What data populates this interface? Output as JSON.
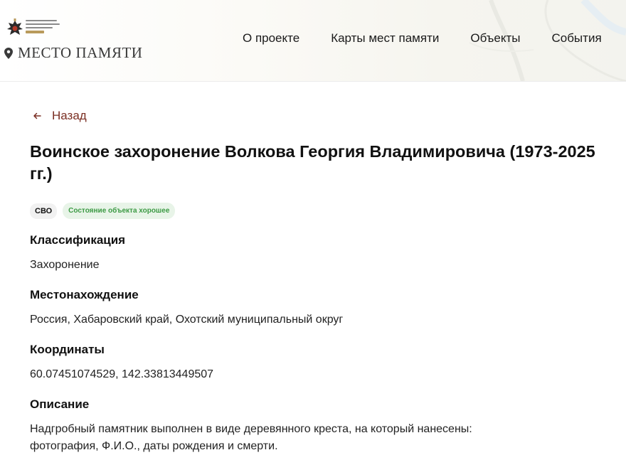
{
  "header": {
    "place_title": "МЕСТО ПАМЯТИ",
    "nav": [
      "О проекте",
      "Карты мест памяти",
      "Объекты",
      "События"
    ]
  },
  "back_label": "Назад",
  "title": "Воинское захоронение Волкова Георгия Владимировича (1973-2025 гг.)",
  "badges": {
    "tag": "СВО",
    "state": "Состояние объекта хорошее"
  },
  "fields": [
    {
      "label": "Классификация",
      "value": "Захоронение"
    },
    {
      "label": "Местонахождение",
      "value": "Россия, Хабаровский край, Охотский муниципальный округ"
    },
    {
      "label": "Координаты",
      "value": "60.07451074529, 142.33813449507"
    },
    {
      "label": "Описание",
      "value": "Надгробный памятник выполнен в виде деревянного креста, на который нанесены: фотография, Ф.И.О., даты рождения и смерти."
    }
  ],
  "colors": {
    "accent": "#7a2e22",
    "state_text": "#3c9a44",
    "state_bg": "#e8f4e8"
  },
  "icons": [
    "rvio-logo-icon",
    "map-pin-icon",
    "arrow-left-icon"
  ]
}
